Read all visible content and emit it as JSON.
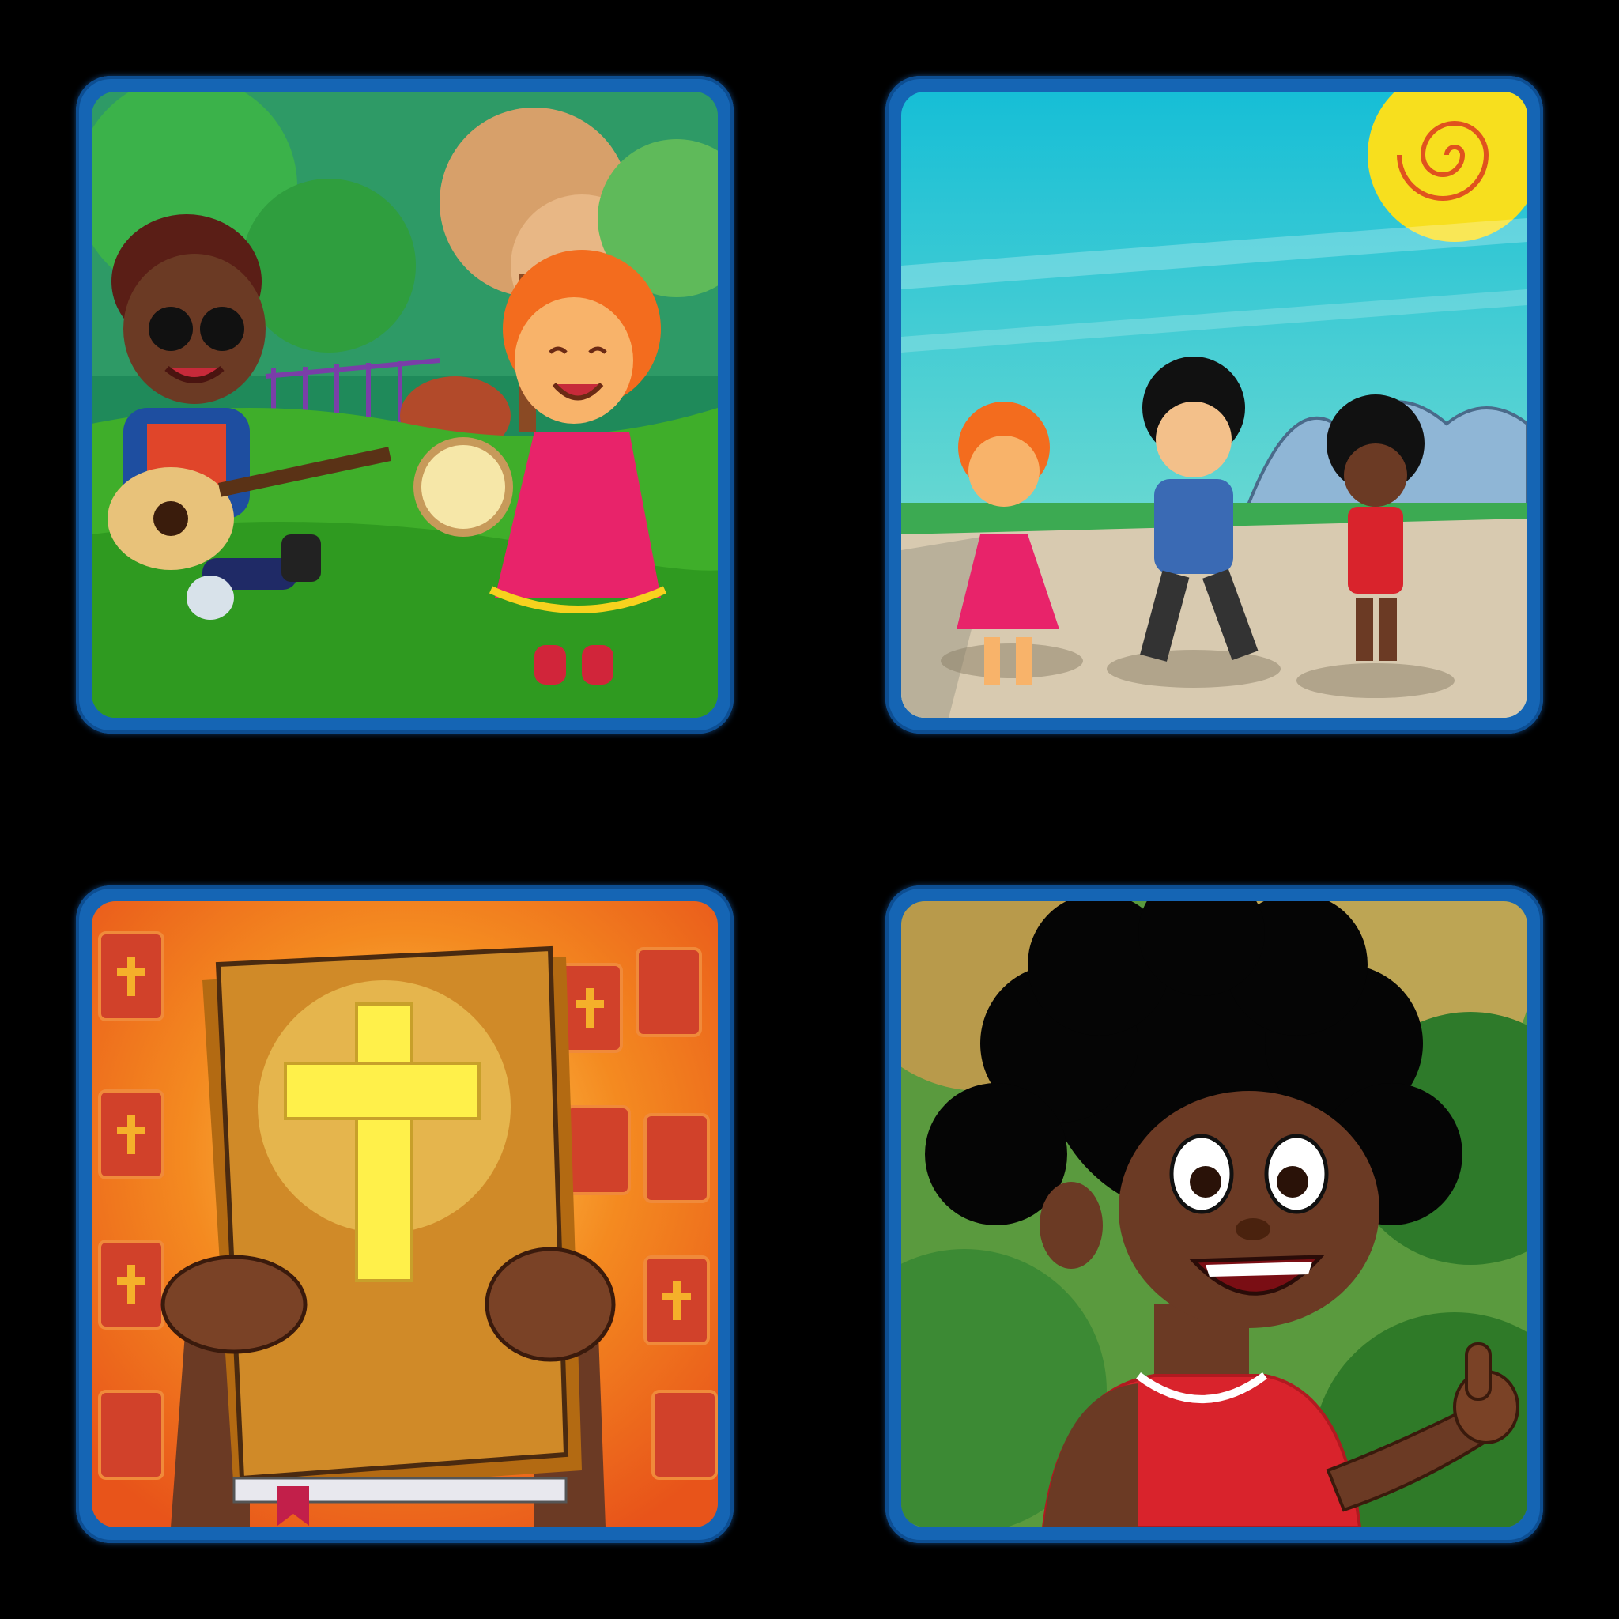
{
  "tiles": [
    {
      "id": "tile-1",
      "scene": "kids-music-park-scene",
      "frame_color": "#1565b4"
    },
    {
      "id": "tile-2",
      "scene": "kids-jumping-sunny-scene",
      "frame_color": "#1565b4"
    },
    {
      "id": "tile-3",
      "scene": "hands-holding-bible-scene",
      "frame_color": "#1565b4"
    },
    {
      "id": "tile-4",
      "scene": "boy-thumbs-up-scene",
      "frame_color": "#1565b4"
    }
  ],
  "colors": {
    "background": "#000000",
    "frame_blue": "#1565b4",
    "grass": "#3fae2a",
    "sky": "#35c4d8",
    "sun": "#f7df1e",
    "orange_rays": "#f26b12",
    "bible_cover": "#c7831d",
    "cross": "#fff04a",
    "jersey_red": "#d9232c"
  }
}
